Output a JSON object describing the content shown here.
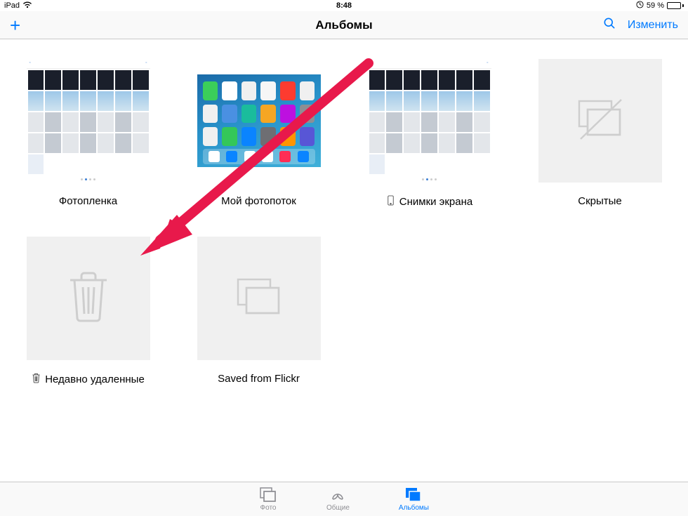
{
  "status": {
    "device": "iPad",
    "time": "8:48",
    "battery_text": "59 %",
    "battery_level": 59,
    "orientation_lock": true
  },
  "nav": {
    "title": "Альбомы",
    "edit_label": "Изменить"
  },
  "albums": [
    {
      "id": "camera-roll",
      "label": "Фотопленка",
      "type": "grid",
      "icon": null
    },
    {
      "id": "photo-stream",
      "label": "Мой фотопоток",
      "type": "ipad",
      "icon": null
    },
    {
      "id": "screenshots",
      "label": "Снимки экрана",
      "type": "grid",
      "icon": "device"
    },
    {
      "id": "hidden",
      "label": "Скрытые",
      "type": "placeholder-hidden",
      "icon": null
    },
    {
      "id": "recently-deleted",
      "label": "Недавно удаленные",
      "type": "placeholder-trash",
      "icon": "trash"
    },
    {
      "id": "saved-flickr",
      "label": "Saved from Flickr",
      "type": "placeholder-stack",
      "icon": null
    }
  ],
  "tabs": [
    {
      "id": "photos",
      "label": "Фото",
      "active": false
    },
    {
      "id": "shared",
      "label": "Общие",
      "active": false
    },
    {
      "id": "albums",
      "label": "Альбомы",
      "active": true
    }
  ],
  "colors": {
    "accent": "#007aff",
    "annotation": "#e8194b"
  }
}
